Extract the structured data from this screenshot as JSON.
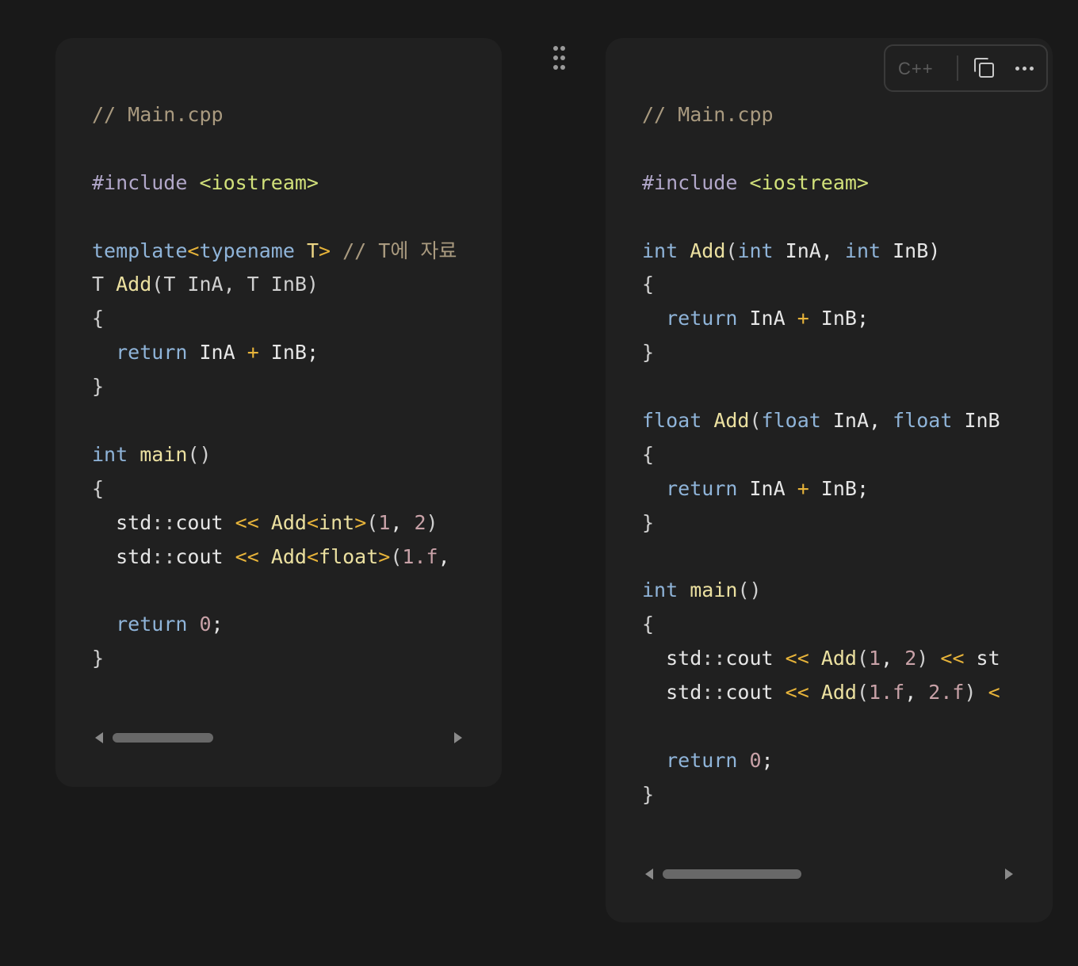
{
  "left_block": {
    "lines": [
      [
        {
          "t": "// Main.cpp",
          "c": "cm"
        }
      ],
      [],
      [
        {
          "t": "#include ",
          "c": "pre"
        },
        {
          "t": "<iostream>",
          "c": "str"
        }
      ],
      [],
      [
        {
          "t": "template",
          "c": "kw"
        },
        {
          "t": "<",
          "c": "op"
        },
        {
          "t": "typename",
          "c": "kw"
        },
        {
          "t": " T",
          "c": "tp"
        },
        {
          "t": ">",
          "c": "op"
        },
        {
          "t": " // T에 자료",
          "c": "cm"
        }
      ],
      [
        {
          "t": "T ",
          "c": "pu"
        },
        {
          "t": "Add",
          "c": "fn"
        },
        {
          "t": "(T InA, T InB)",
          "c": "pu"
        }
      ],
      [
        {
          "t": "{",
          "c": "pu"
        }
      ],
      [
        {
          "t": "  "
        },
        {
          "t": "return",
          "c": "kw"
        },
        {
          "t": " InA "
        },
        {
          "t": "+",
          "c": "op"
        },
        {
          "t": " InB;"
        }
      ],
      [
        {
          "t": "}",
          "c": "pu"
        }
      ],
      [],
      [
        {
          "t": "int",
          "c": "kw"
        },
        {
          "t": " "
        },
        {
          "t": "main",
          "c": "fn"
        },
        {
          "t": "()",
          "c": "pu"
        }
      ],
      [
        {
          "t": "{",
          "c": "pu"
        }
      ],
      [
        {
          "t": "  std"
        },
        {
          "t": "::",
          "c": "pu"
        },
        {
          "t": "cout "
        },
        {
          "t": "<<",
          "c": "op"
        },
        {
          "t": " "
        },
        {
          "t": "Add",
          "c": "fn"
        },
        {
          "t": "<",
          "c": "op"
        },
        {
          "t": "int",
          "c": "fn"
        },
        {
          "t": ">",
          "c": "op"
        },
        {
          "t": "(",
          "c": "pu"
        },
        {
          "t": "1",
          "c": "num"
        },
        {
          "t": ", "
        },
        {
          "t": "2",
          "c": "num"
        },
        {
          "t": ")",
          "c": "pu"
        }
      ],
      [
        {
          "t": "  std"
        },
        {
          "t": "::",
          "c": "pu"
        },
        {
          "t": "cout "
        },
        {
          "t": "<<",
          "c": "op"
        },
        {
          "t": " "
        },
        {
          "t": "Add",
          "c": "fn"
        },
        {
          "t": "<",
          "c": "op"
        },
        {
          "t": "float",
          "c": "fn"
        },
        {
          "t": ">",
          "c": "op"
        },
        {
          "t": "(",
          "c": "pu"
        },
        {
          "t": "1.f",
          "c": "num"
        },
        {
          "t": ","
        }
      ],
      [],
      [
        {
          "t": "  "
        },
        {
          "t": "return",
          "c": "kw"
        },
        {
          "t": " "
        },
        {
          "t": "0",
          "c": "num"
        },
        {
          "t": ";"
        }
      ],
      [
        {
          "t": "}",
          "c": "pu"
        }
      ]
    ]
  },
  "right_block": {
    "toolbar": {
      "language_label": "C++",
      "copy_icon": "copy-icon",
      "more_icon": "more-icon"
    },
    "lines": [
      [
        {
          "t": "// Main.cpp",
          "c": "cm"
        }
      ],
      [],
      [
        {
          "t": "#include ",
          "c": "pre"
        },
        {
          "t": "<iostream>",
          "c": "str"
        }
      ],
      [],
      [
        {
          "t": "int",
          "c": "kw"
        },
        {
          "t": " "
        },
        {
          "t": "Add",
          "c": "fn"
        },
        {
          "t": "(",
          "c": "pu"
        },
        {
          "t": "int",
          "c": "kw"
        },
        {
          "t": " InA, "
        },
        {
          "t": "int",
          "c": "kw"
        },
        {
          "t": " InB)"
        }
      ],
      [
        {
          "t": "{",
          "c": "pu"
        }
      ],
      [
        {
          "t": "  "
        },
        {
          "t": "return",
          "c": "kw"
        },
        {
          "t": " InA "
        },
        {
          "t": "+",
          "c": "op"
        },
        {
          "t": " InB;"
        }
      ],
      [
        {
          "t": "}",
          "c": "pu"
        }
      ],
      [],
      [
        {
          "t": "float",
          "c": "kw"
        },
        {
          "t": " "
        },
        {
          "t": "Add",
          "c": "fn"
        },
        {
          "t": "(",
          "c": "pu"
        },
        {
          "t": "float",
          "c": "kw"
        },
        {
          "t": " InA, "
        },
        {
          "t": "float",
          "c": "kw"
        },
        {
          "t": " InB"
        }
      ],
      [
        {
          "t": "{",
          "c": "pu"
        }
      ],
      [
        {
          "t": "  "
        },
        {
          "t": "return",
          "c": "kw"
        },
        {
          "t": " InA "
        },
        {
          "t": "+",
          "c": "op"
        },
        {
          "t": " InB;"
        }
      ],
      [
        {
          "t": "}",
          "c": "pu"
        }
      ],
      [],
      [
        {
          "t": "int",
          "c": "kw"
        },
        {
          "t": " "
        },
        {
          "t": "main",
          "c": "fn"
        },
        {
          "t": "()",
          "c": "pu"
        }
      ],
      [
        {
          "t": "{",
          "c": "pu"
        }
      ],
      [
        {
          "t": "  std"
        },
        {
          "t": "::",
          "c": "pu"
        },
        {
          "t": "cout "
        },
        {
          "t": "<<",
          "c": "op"
        },
        {
          "t": " "
        },
        {
          "t": "Add",
          "c": "fn"
        },
        {
          "t": "(",
          "c": "pu"
        },
        {
          "t": "1",
          "c": "num"
        },
        {
          "t": ", "
        },
        {
          "t": "2",
          "c": "num"
        },
        {
          "t": ")",
          "c": "pu"
        },
        {
          "t": " "
        },
        {
          "t": "<<",
          "c": "op"
        },
        {
          "t": " st"
        }
      ],
      [
        {
          "t": "  std"
        },
        {
          "t": "::",
          "c": "pu"
        },
        {
          "t": "cout "
        },
        {
          "t": "<<",
          "c": "op"
        },
        {
          "t": " "
        },
        {
          "t": "Add",
          "c": "fn"
        },
        {
          "t": "(",
          "c": "pu"
        },
        {
          "t": "1.f",
          "c": "num"
        },
        {
          "t": ", "
        },
        {
          "t": "2.f",
          "c": "num"
        },
        {
          "t": ")",
          "c": "pu"
        },
        {
          "t": " "
        },
        {
          "t": "<",
          "c": "op"
        }
      ],
      [],
      [
        {
          "t": "  "
        },
        {
          "t": "return",
          "c": "kw"
        },
        {
          "t": " "
        },
        {
          "t": "0",
          "c": "num"
        },
        {
          "t": ";"
        }
      ],
      [
        {
          "t": "}",
          "c": "pu"
        }
      ]
    ]
  },
  "icons": {
    "drag_handle": "drag-handle-icon",
    "scroll_left": "scroll-left-arrow-icon",
    "scroll_right": "scroll-right-arrow-icon"
  }
}
